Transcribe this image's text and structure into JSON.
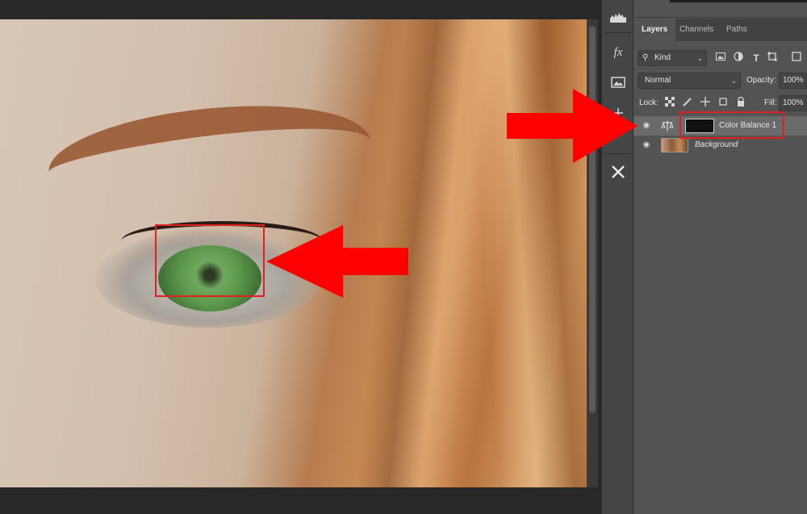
{
  "panel": {
    "tabs": [
      {
        "label": "Layers",
        "active": true
      },
      {
        "label": "Channels",
        "active": false
      },
      {
        "label": "Paths",
        "active": false
      }
    ],
    "filter": {
      "kind_label": "Kind"
    },
    "blend_mode": {
      "value": "Normal"
    },
    "opacity": {
      "label": "Opacity:",
      "value": "100%"
    },
    "lock": {
      "label": "Lock:"
    },
    "fill": {
      "label": "Fill:",
      "value": "100%"
    },
    "layers": [
      {
        "name": "Color Balance 1",
        "selected": true,
        "visible": true
      },
      {
        "name": "Background",
        "selected": false,
        "visible": true
      }
    ]
  },
  "tools": {
    "icons": [
      "histogram-icon",
      "fx-icon",
      "adjustment-folder-icon",
      "adjustment-scale-icon",
      "magic-wand-cross-icon"
    ],
    "fx_label": "fx"
  },
  "annotations": {
    "highlight_color": "#e0201c",
    "arrow_color": "#ff0000"
  },
  "canvas": {
    "subject": "close-up of green eye"
  }
}
